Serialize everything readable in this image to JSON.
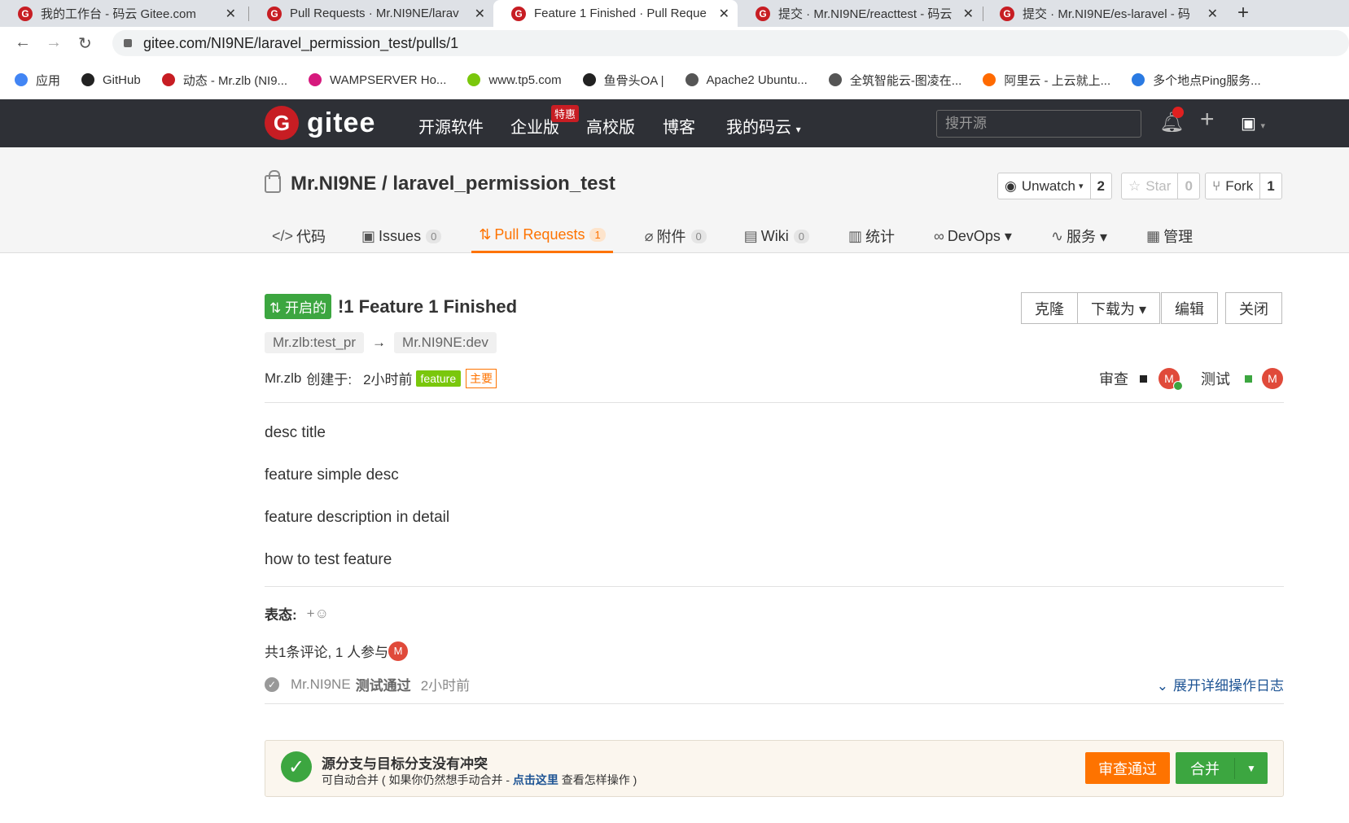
{
  "browser": {
    "tabs": [
      {
        "title": "我的工作台 - 码云 Gitee.com"
      },
      {
        "title": "Pull Requests · Mr.NI9NE/larav"
      },
      {
        "title": "Feature 1 Finished · Pull Reque"
      },
      {
        "title": "提交 · Mr.NI9NE/reacttest - 码云"
      },
      {
        "title": "提交 · Mr.NI9NE/es-laravel - 码"
      }
    ],
    "url": "gitee.com/NI9NE/laravel_permission_test/pulls/1",
    "bookmarks": [
      {
        "label": "应用",
        "color": "#4285f4"
      },
      {
        "label": "GitHub",
        "color": "#222222"
      },
      {
        "label": "动态 - Mr.zlb (NI9...",
        "color": "#c71d23"
      },
      {
        "label": "WAMPSERVER Ho...",
        "color": "#d6197d"
      },
      {
        "label": "www.tp5.com",
        "color": "#7ac70c"
      },
      {
        "label": "鱼骨头OA |",
        "color": "#222222"
      },
      {
        "label": "Apache2 Ubuntu...",
        "color": "#555555"
      },
      {
        "label": "全筑智能云-图凌在...",
        "color": "#555555"
      },
      {
        "label": "阿里云 - 上云就上...",
        "color": "#ff6a00"
      },
      {
        "label": "多个地点Ping服务...",
        "color": "#2a7ae2"
      }
    ]
  },
  "header": {
    "logo_text": "gitee",
    "logo_letter": "G",
    "nav": [
      "开源软件",
      "企业版",
      "高校版",
      "博客",
      "我的码云"
    ],
    "badge": "特惠",
    "search_placeholder": "搜开源"
  },
  "repo": {
    "title": "Mr.NI9NE / laravel_permission_test",
    "watch_label": "Unwatch",
    "watch_count": "2",
    "star_label": "Star",
    "star_count": "0",
    "fork_label": "Fork",
    "fork_count": "1",
    "tabs": [
      {
        "label": "代码",
        "icon": "</>",
        "count": ""
      },
      {
        "label": "Issues",
        "icon": "▣",
        "count": "0"
      },
      {
        "label": "Pull Requests",
        "icon": "⇅",
        "count": "1"
      },
      {
        "label": "附件",
        "icon": "⌀",
        "count": "0"
      },
      {
        "label": "Wiki",
        "icon": "▤",
        "count": "0"
      },
      {
        "label": "统计",
        "icon": "▥",
        "count": ""
      },
      {
        "label": "DevOps ▾",
        "icon": "∞",
        "count": ""
      },
      {
        "label": "服务 ▾",
        "icon": "∿",
        "count": ""
      },
      {
        "label": "管理",
        "icon": "▦",
        "count": ""
      }
    ]
  },
  "pr": {
    "status": "开启的",
    "title": "!1 Feature 1 Finished",
    "actions": [
      "克隆",
      "下载为 ▾",
      "编辑",
      "关闭"
    ],
    "source_branch": "Mr.zlb:test_pr",
    "arrow": "→",
    "target_branch": "Mr.NI9NE:dev",
    "author": "Mr.zlb",
    "created_label": "创建于:",
    "created_time": "2小时前",
    "tag_feature": "feature",
    "tag_main": "主要",
    "review_label": "审查",
    "test_label": "测试",
    "avatar_letter": "M",
    "description": [
      "desc title",
      "feature simple desc",
      "feature description in detail",
      "how to test feature"
    ],
    "reactions_label": "表态:",
    "reactions_add": "+☺",
    "comments_text": "共1条评论, 1 人参与",
    "log_user": "Mr.NI9NE",
    "log_action": "测试通过",
    "log_time": "2小时前",
    "log_expand": "展开详细操作日志",
    "merge_title": "源分支与目标分支没有冲突",
    "merge_hint_pre": "可自动合并 ( 如果你仍然想手动合并 - ",
    "merge_hint_link": "点击这里",
    "merge_hint_post": " 查看怎样操作 )",
    "approve_button": "审查通过",
    "merge_button": "合并"
  }
}
